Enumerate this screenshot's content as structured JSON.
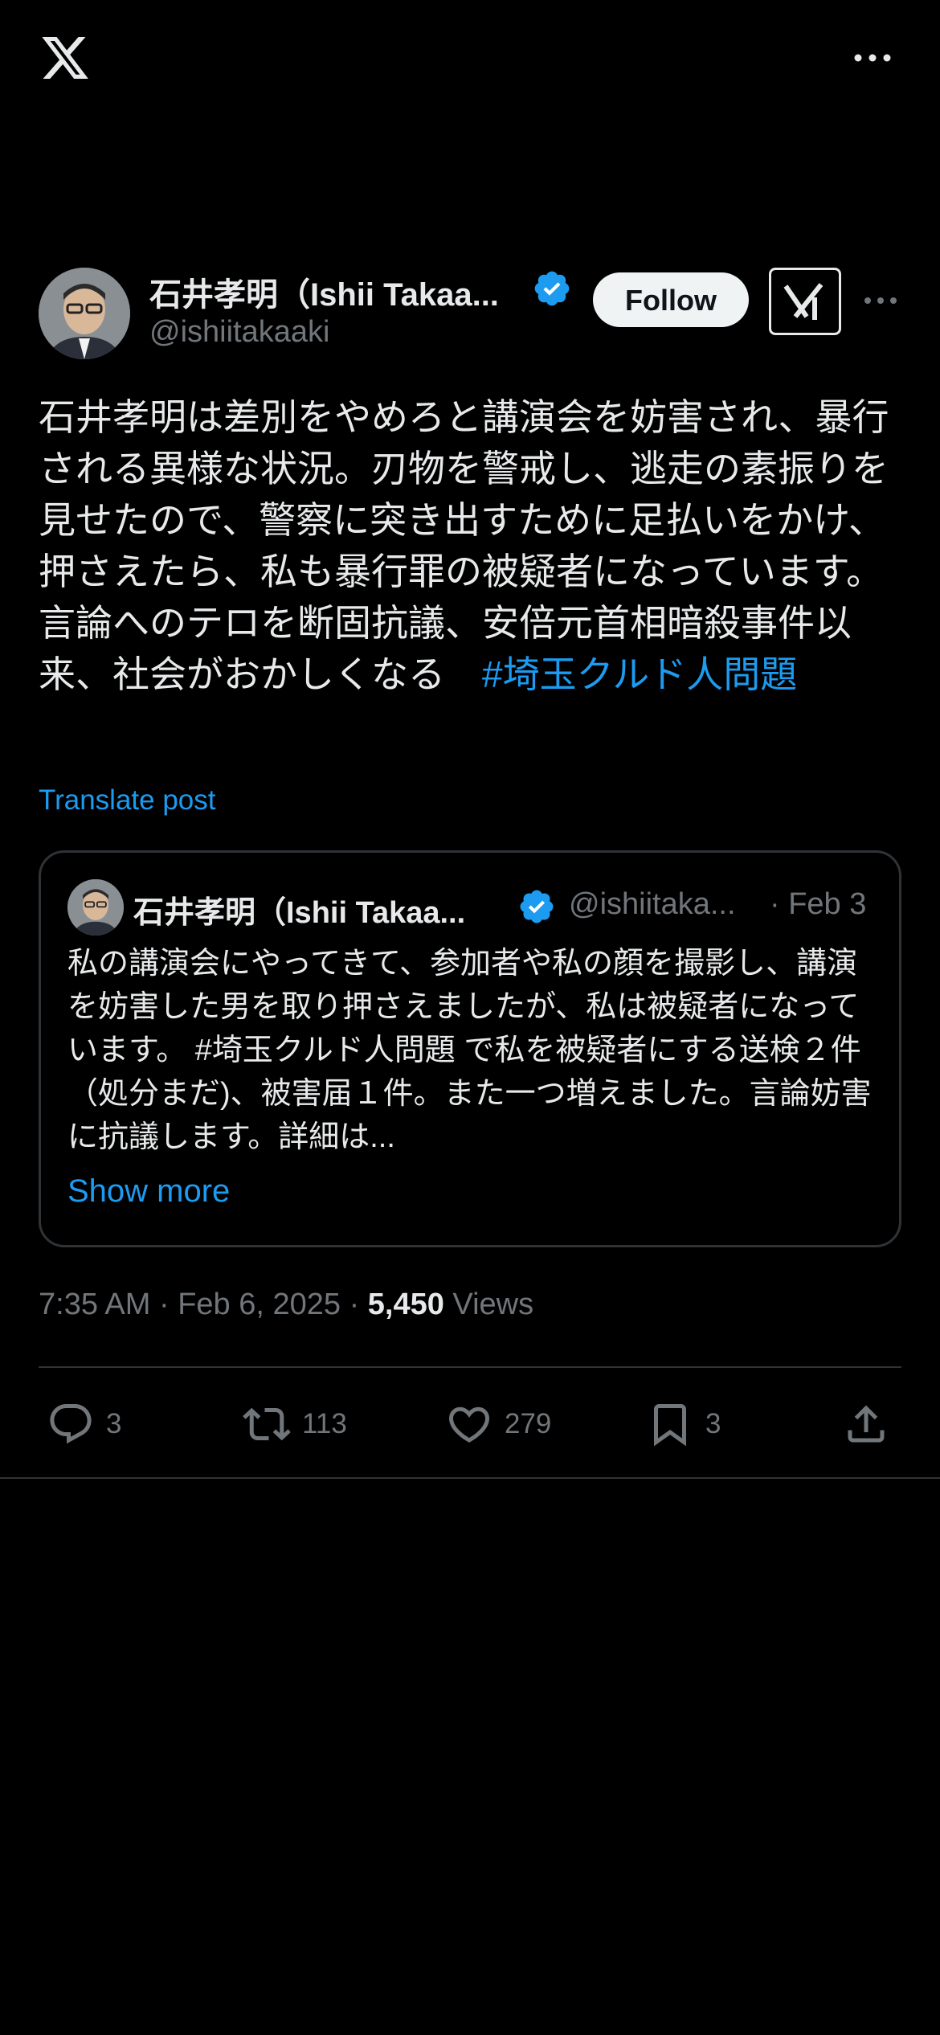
{
  "topbar": {
    "logo_icon": "x-logo-icon",
    "more_icon": "more-horizontal-icon"
  },
  "author": {
    "name": "石井孝明（Ishii Takaa...",
    "handle": "@ishiitakaaki",
    "verified_icon": "verified-badge-icon"
  },
  "header": {
    "follow_label": "Follow",
    "grok_icon": "grok-icon",
    "more_icon": "more-horizontal-icon"
  },
  "post": {
    "text": "石井孝明は差別をやめろと講演会を妨害され、暴行される異様な状況。刃物を警戒し、逃走の素振りを見せたので、警察に突き出すために足払いをかけ、押さえたら、私も暴行罪の被疑者になっています。言論へのテロを断固抗議、安倍元首相暗殺事件以来、社会がおかしくなる　",
    "hashtag": "#埼玉クルド人問題",
    "translate_label": "Translate post"
  },
  "quote": {
    "name": "石井孝明（Ishii Takaa...",
    "handle": "@ishiitaka...",
    "date": "· Feb 3",
    "text_part1": "私の講演会にやってきて、参加者や私の顔を撮影し、講演を妨害した男を取り押さえましたが、私は被疑者になっています。 ",
    "hashtag": "#埼玉クルド人問題",
    "text_part2": " で私を被疑者にする送検２件（処分まだ)、被害届１件。また一つ増えました。言論妨害に抗議します。詳細は...",
    "show_more": "Show more"
  },
  "meta": {
    "time": "7:35 AM · Feb 6, 2025 · ",
    "views_count": "5,450",
    "views_label": " Views"
  },
  "actions": {
    "replies": "3",
    "reposts": "113",
    "likes": "279",
    "bookmarks": "3"
  },
  "colors": {
    "background": "#000000",
    "accent": "#1d9bf0",
    "muted": "#71767b",
    "text": "#e7e9ea"
  }
}
